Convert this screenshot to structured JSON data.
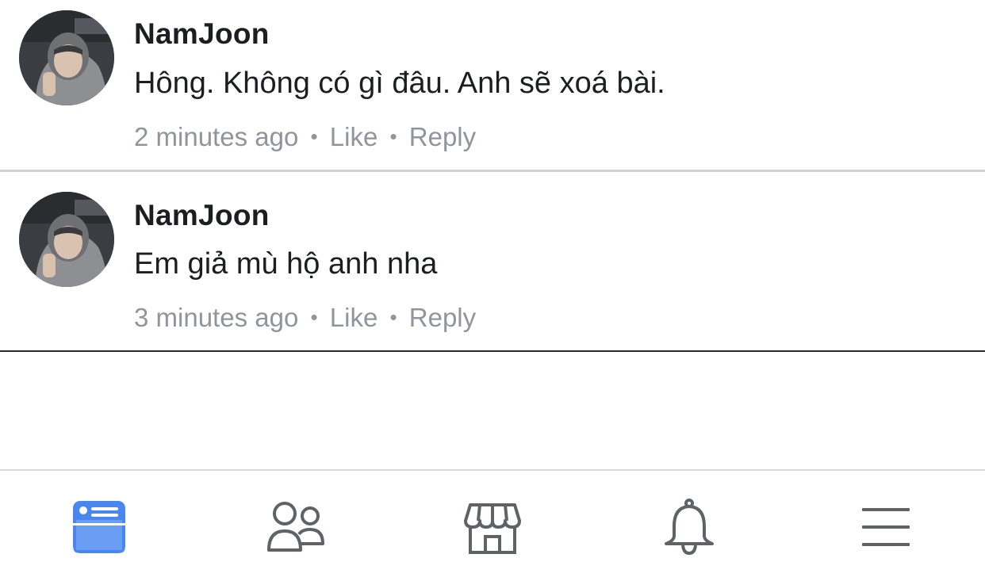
{
  "comments": [
    {
      "author": "NamJoon",
      "text": "Hông. Không có gì đâu. Anh sẽ xoá bài.",
      "time": "2 minutes ago",
      "like_label": "Like",
      "reply_label": "Reply",
      "separator": "•"
    },
    {
      "author": "NamJoon",
      "text": "Em giả mù hộ anh nha",
      "time": "3 minutes ago",
      "like_label": "Like",
      "reply_label": "Reply",
      "separator": "•"
    }
  ],
  "tabbar": {
    "items": [
      {
        "icon": "news-feed-icon",
        "active": true
      },
      {
        "icon": "friends-icon",
        "active": false
      },
      {
        "icon": "marketplace-icon",
        "active": false
      },
      {
        "icon": "notifications-bell-icon",
        "active": false
      },
      {
        "icon": "menu-icon",
        "active": false
      }
    ]
  },
  "colors": {
    "active_tab": "#4a86f0",
    "inactive_tab": "#5f6368",
    "meta_text": "#90949c",
    "primary_text": "#1c1e21"
  }
}
